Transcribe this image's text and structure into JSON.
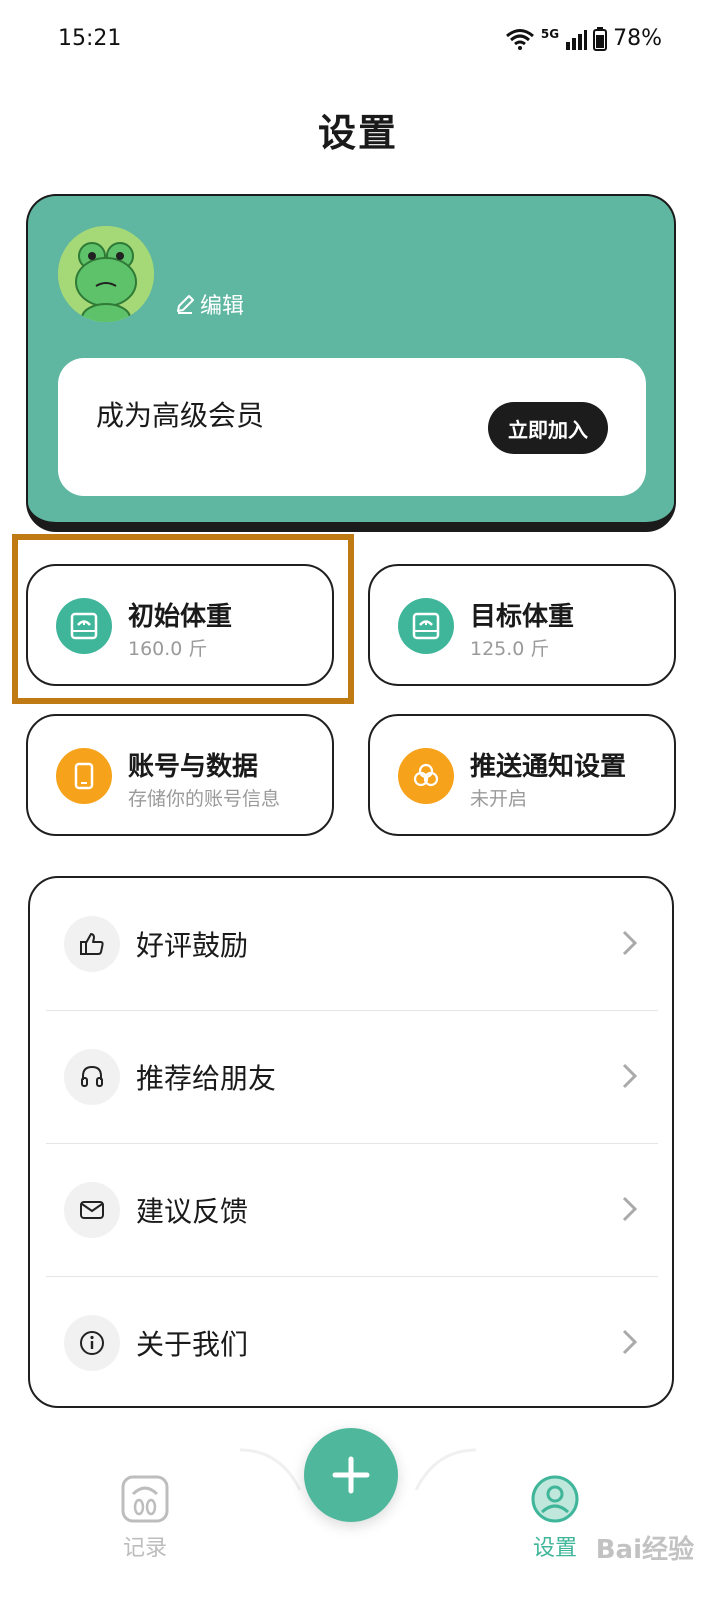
{
  "status_bar": {
    "time": "15:21",
    "network": "5G",
    "battery": "78%"
  },
  "page": {
    "title": "设置"
  },
  "profile": {
    "edit_label": "编辑",
    "vip_text": "成为高级会员",
    "join_label": "立即加入",
    "accent_color": "#5fb7a1"
  },
  "tiles": [
    {
      "title": "初始体重",
      "subtitle": "160.0 斤",
      "icon": "scale-icon",
      "color": "#3fb59a"
    },
    {
      "title": "目标体重",
      "subtitle": "125.0 斤",
      "icon": "scale-icon",
      "color": "#3fb59a"
    },
    {
      "title": "账号与数据",
      "subtitle": "存储你的账号信息",
      "icon": "phone-icon",
      "color": "#f7a21b"
    },
    {
      "title": "推送通知设置",
      "subtitle": "未开启",
      "icon": "circles-icon",
      "color": "#f7a21b"
    }
  ],
  "list": [
    {
      "label": "好评鼓励",
      "icon": "thumbs-up-icon"
    },
    {
      "label": "推荐给朋友",
      "icon": "headset-icon"
    },
    {
      "label": "建议反馈",
      "icon": "mail-icon"
    },
    {
      "label": "关于我们",
      "icon": "info-icon"
    }
  ],
  "bottom_nav": {
    "items": [
      {
        "label": "记录",
        "icon": "scale-outline-icon"
      },
      {
        "label": "设置",
        "icon": "user-icon"
      }
    ],
    "fab_icon": "plus-icon",
    "active_color": "#3fb59a"
  },
  "watermark": "Bai经验"
}
